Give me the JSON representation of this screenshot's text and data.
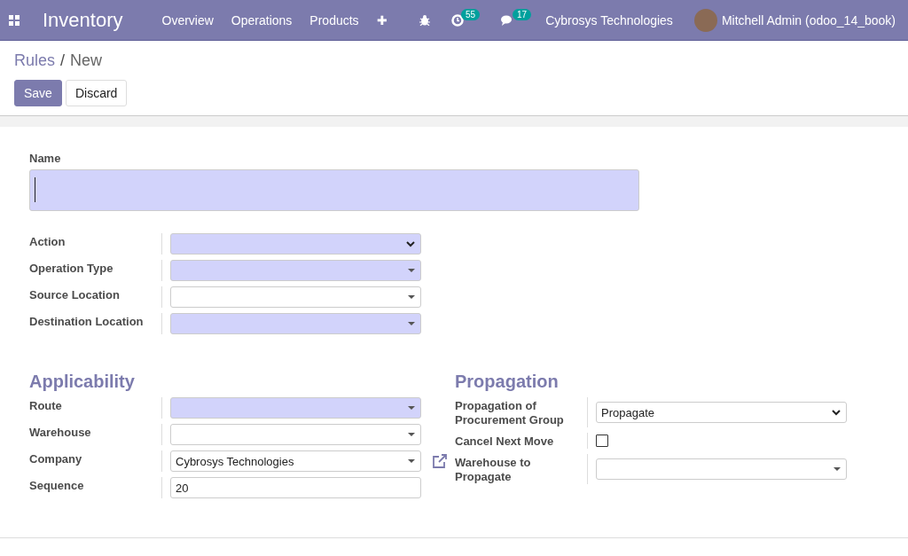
{
  "navbar": {
    "app_name": "Inventory",
    "menu": [
      "Overview",
      "Operations",
      "Products",
      "✚"
    ],
    "activity_count": "55",
    "message_count": "17",
    "company": "Cybrosys Technologies",
    "user": "Mitchell Admin (odoo_14_book)"
  },
  "breadcrumb": {
    "parent": "Rules",
    "separator": "/",
    "current": "New"
  },
  "buttons": [
    {
      "label": "Save",
      "kind": "primary"
    },
    {
      "label": "Discard",
      "kind": "secondary"
    }
  ],
  "name_field": {
    "label": "Name",
    "required": true
  },
  "main_fields": [
    {
      "label": "Action",
      "kind": "select",
      "required": true
    },
    {
      "label": "Operation Type",
      "kind": "many2one",
      "required": true
    },
    {
      "label": "Source Location",
      "kind": "many2one",
      "required": false
    },
    {
      "label": "Destination Location",
      "kind": "many2one",
      "required": true
    }
  ],
  "applicability": {
    "title": "Applicability",
    "fields": [
      {
        "label": "Route",
        "kind": "many2one",
        "required": true
      },
      {
        "label": "Warehouse",
        "kind": "many2one",
        "required": false
      },
      {
        "label": "Company",
        "kind": "many2one",
        "required": false,
        "value": "Cybrosys Technologies",
        "external_link": true
      },
      {
        "label": "Sequence",
        "kind": "input",
        "required": false,
        "value": "20"
      }
    ]
  },
  "propagation": {
    "title": "Propagation",
    "fields": [
      {
        "label": "Propagation of Procurement Group",
        "kind": "select",
        "required": false,
        "value": "Propagate"
      },
      {
        "label": "Cancel Next Move",
        "kind": "checkbox",
        "checked": false
      },
      {
        "label": "Warehouse to Propagate",
        "kind": "many2one",
        "required": false
      }
    ]
  }
}
